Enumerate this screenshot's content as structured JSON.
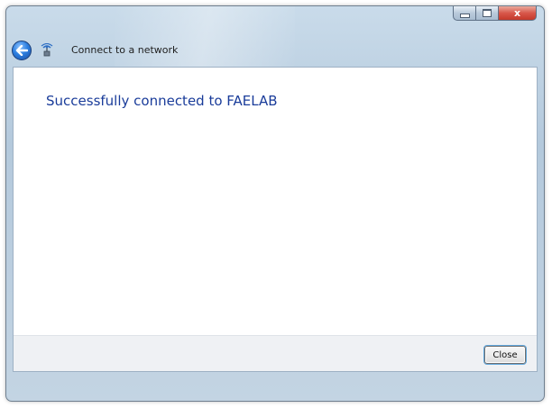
{
  "window": {
    "title": "Connect to a network",
    "accent_color": "#1a3c9a"
  },
  "caption_buttons": {
    "minimize_icon": "minimize-icon",
    "maximize_icon": "maximize-icon",
    "close_glyph": "x"
  },
  "nav": {
    "back_icon": "back-arrow-icon",
    "network_icon": "network-icon"
  },
  "content": {
    "message": "Successfully connected to FAELAB"
  },
  "footer": {
    "close_label": "Close"
  }
}
